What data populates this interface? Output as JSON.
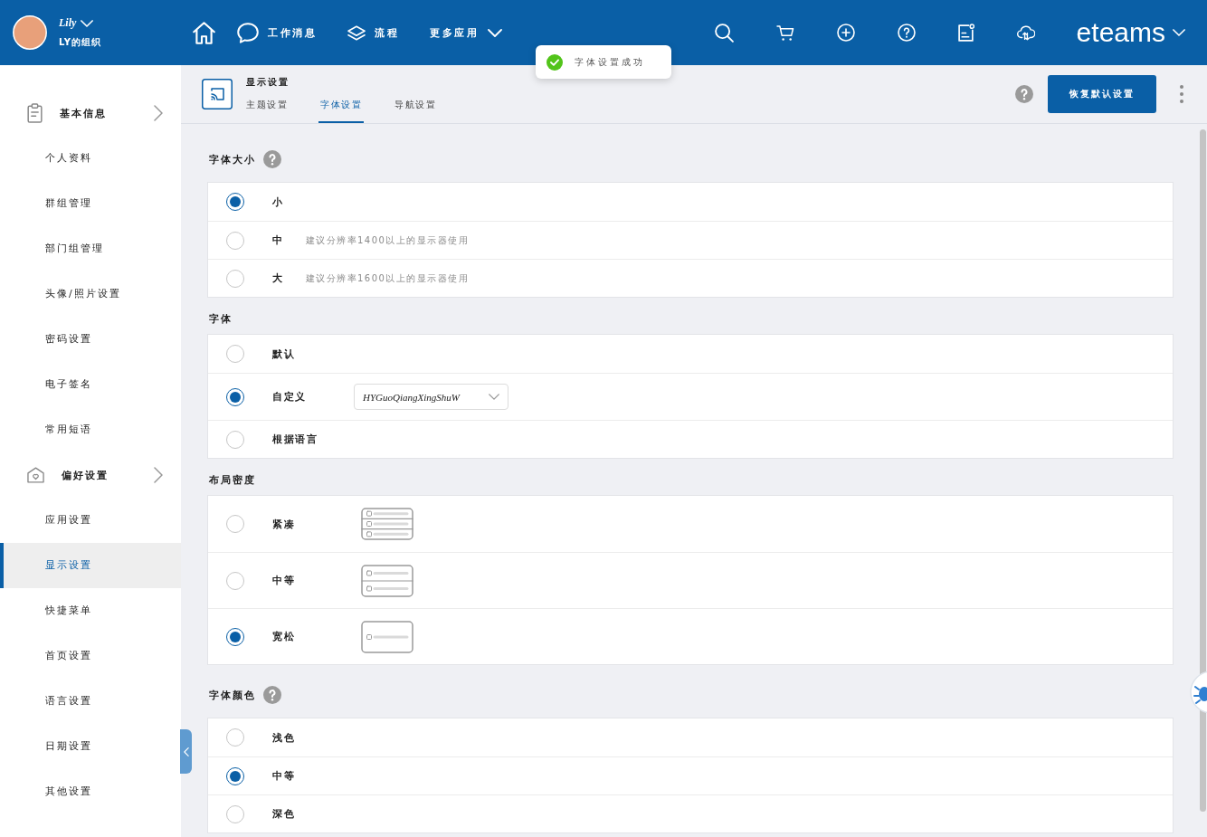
{
  "top_bar": {
    "user": {
      "name": "Lily",
      "org": "LY的组织"
    },
    "nav": [
      {
        "kind": "home"
      },
      {
        "kind": "messages",
        "label": "工作消息"
      },
      {
        "kind": "workflow",
        "label": "流程"
      },
      {
        "kind": "more",
        "label": "更多应用"
      }
    ],
    "brand": "eteams"
  },
  "toast": {
    "message": "字体设置成功"
  },
  "sidebar": {
    "groups": [
      {
        "kind": "basic",
        "label": "基本信息",
        "items": [
          {
            "label": "个人资料",
            "selected": false
          },
          {
            "label": "群组管理",
            "selected": false
          },
          {
            "label": "部门组管理",
            "selected": false
          },
          {
            "label": "头像/照片设置",
            "selected": false
          },
          {
            "label": "密码设置",
            "selected": false
          },
          {
            "label": "电子签名",
            "selected": false
          },
          {
            "label": "常用短语",
            "selected": false
          }
        ]
      },
      {
        "kind": "preferences",
        "label": "偏好设置",
        "items": [
          {
            "label": "应用设置",
            "selected": false
          },
          {
            "label": "显示设置",
            "selected": true
          },
          {
            "label": "快捷菜单",
            "selected": false
          },
          {
            "label": "首页设置",
            "selected": false
          },
          {
            "label": "语言设置",
            "selected": false
          },
          {
            "label": "日期设置",
            "selected": false
          },
          {
            "label": "其他设置",
            "selected": false
          }
        ]
      }
    ]
  },
  "page_header": {
    "title": "显示设置",
    "tabs": [
      {
        "label": "主题设置",
        "selected": false
      },
      {
        "label": "字体设置",
        "selected": true
      },
      {
        "label": "导航设置",
        "selected": false
      }
    ],
    "reset_button": "恢复默认设置"
  },
  "sections": [
    {
      "title": "字体大小",
      "help": true,
      "options": [
        {
          "label": "小",
          "selected": true
        },
        {
          "label": "中",
          "hint": "建议分辨率1400以上的显示器使用",
          "selected": false
        },
        {
          "label": "大",
          "hint": "建议分辨率1600以上的显示器使用",
          "selected": false
        }
      ]
    },
    {
      "title": "字体",
      "help": false,
      "options": [
        {
          "label": "默认",
          "selected": false
        },
        {
          "label": "自定义",
          "selected": true,
          "dropdown": {
            "value": "HYGuoQiangXingShuW"
          }
        },
        {
          "label": "根据语言",
          "selected": false
        }
      ]
    },
    {
      "title": "布局密度",
      "help": false,
      "options": [
        {
          "kind": "compact",
          "label": "紧凑",
          "selected": false
        },
        {
          "kind": "medium",
          "label": "中等",
          "selected": false
        },
        {
          "kind": "loose",
          "label": "宽松",
          "selected": true
        }
      ]
    },
    {
      "title": "字体颜色",
      "help": true,
      "options": [
        {
          "label": "浅色",
          "selected": false
        },
        {
          "label": "中等",
          "selected": true
        },
        {
          "label": "深色",
          "selected": false
        }
      ]
    }
  ]
}
